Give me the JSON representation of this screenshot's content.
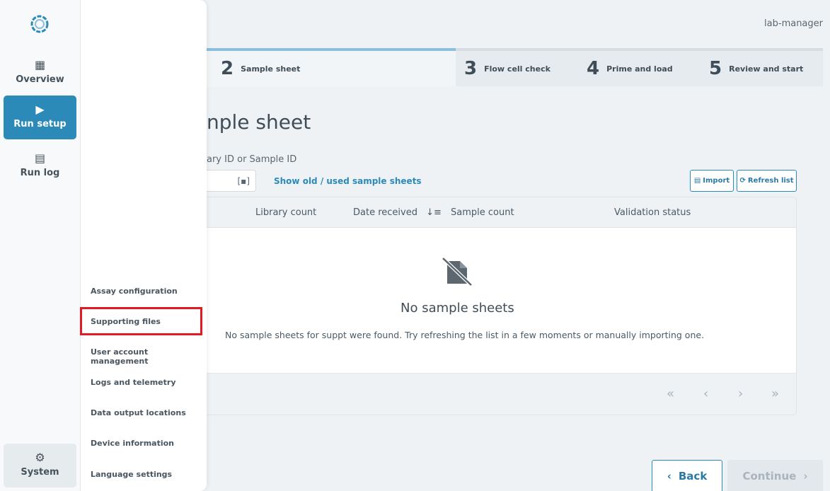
{
  "header": {
    "user": "lab-manager"
  },
  "stepper": {
    "steps": [
      {
        "num": "2",
        "label": "Sample sheet"
      },
      {
        "num": "3",
        "label": "Flow cell check"
      },
      {
        "num": "4",
        "label": "Prime and load"
      },
      {
        "num": "5",
        "label": "Review and start"
      }
    ]
  },
  "main": {
    "title_visible": "nple sheet",
    "search_label_visible": "ary ID or Sample ID",
    "show_old_link": "Show old / used sample sheets",
    "import_label": "Import",
    "refresh_label": "Refresh list"
  },
  "table": {
    "columns": [
      "Library count",
      "Date received",
      "Sample count",
      "Validation status"
    ],
    "empty_title": "No sample sheets",
    "empty_desc": "No sample sheets for suppt were found. Try refreshing the list in a few moments or manually importing one."
  },
  "pagination": {
    "first": "«",
    "prev": "‹",
    "next": "›",
    "last": "»"
  },
  "footer": {
    "back_label": "Back",
    "continue_label": "Continue"
  },
  "rail": {
    "overview": "Overview",
    "run_setup": "Run setup",
    "run_log": "Run log",
    "system": "System"
  },
  "system_menu": {
    "items": [
      "Assay configuration",
      "Supporting files",
      "User account management",
      "Logs and telemetry",
      "Data output locations",
      "Device information",
      "Language settings"
    ]
  },
  "colors": {
    "accent": "#2c8ab8",
    "highlight": "#e01b24"
  }
}
